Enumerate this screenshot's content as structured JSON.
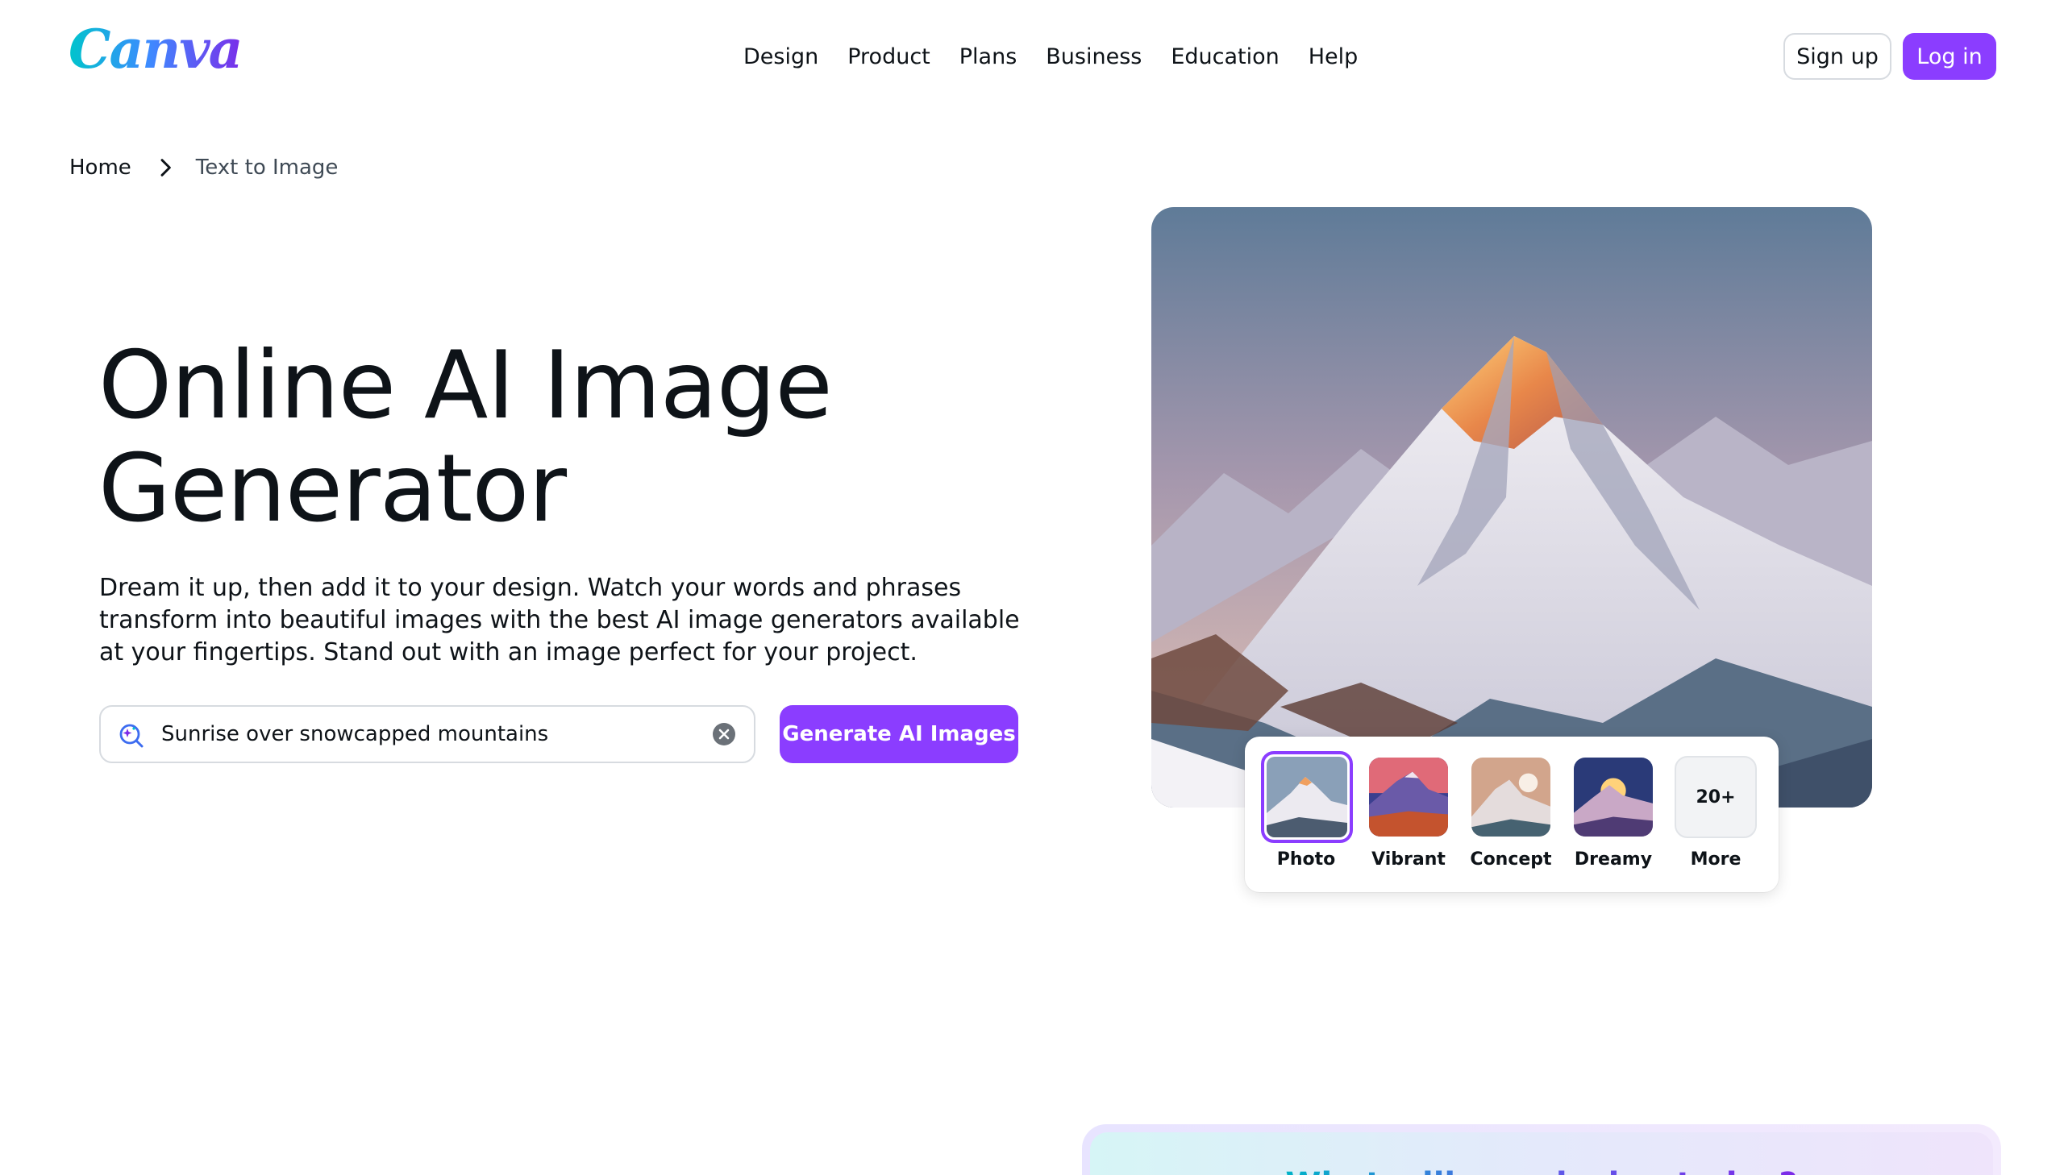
{
  "header": {
    "logo": "Canva",
    "nav": [
      "Design",
      "Product",
      "Plans",
      "Business",
      "Education",
      "Help"
    ],
    "signup_label": "Sign up",
    "login_label": "Log in"
  },
  "breadcrumb": {
    "home": "Home",
    "current": "Text to Image"
  },
  "hero": {
    "title_line1": "Online AI Image",
    "title_line2": "Generator",
    "description": "Dream it up, then add it to your design. Watch your words and phrases transform into beautiful images with the best AI image generators available at your fingertips. Stand out with an image perfect for your project."
  },
  "search": {
    "value": "Sunrise over snowcapped mountains",
    "generate_label": "Generate AI Images"
  },
  "styles": {
    "options": [
      {
        "label": "Photo",
        "selected": true
      },
      {
        "label": "Vibrant",
        "selected": false
      },
      {
        "label": "Concept",
        "selected": false
      },
      {
        "label": "Dreamy",
        "selected": false
      }
    ],
    "more_badge": "20+",
    "more_label": "More"
  },
  "teaser": {
    "text": "What will you design today?"
  },
  "colors": {
    "brand_purple": "#8b3dff",
    "text_dark": "#0e1318",
    "border": "#d7dbe0"
  },
  "icons": {
    "search": "magic-search-icon",
    "clear": "clear-circle-icon",
    "breadcrumb_separator": "chevron-right-icon"
  }
}
